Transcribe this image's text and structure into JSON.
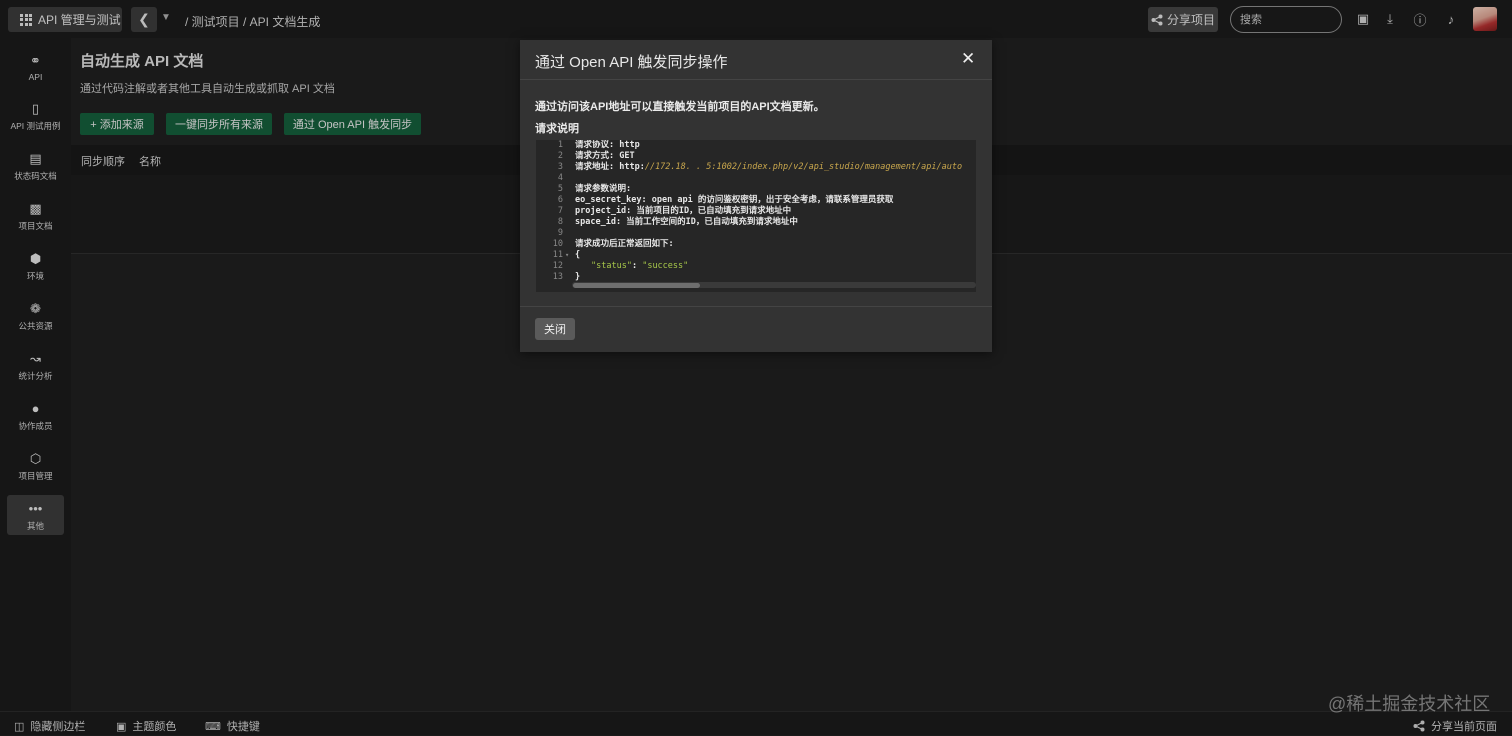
{
  "topbar": {
    "app_label": "API 管理与测试",
    "breadcrumb": "/ 测试项目 / API 文档生成",
    "share_label": "分享项目",
    "search_placeholder": "搜索"
  },
  "sidebar": {
    "items": [
      {
        "label": "API",
        "icon": "link-icon"
      },
      {
        "label": "API 测试用例",
        "icon": "test-case-icon"
      },
      {
        "label": "状态码文档",
        "icon": "status-doc-icon"
      },
      {
        "label": "项目文档",
        "icon": "project-doc-icon"
      },
      {
        "label": "环境",
        "icon": "environment-icon"
      },
      {
        "label": "公共资源",
        "icon": "public-resource-icon"
      },
      {
        "label": "统计分析",
        "icon": "chart-icon"
      },
      {
        "label": "协作成员",
        "icon": "member-icon"
      },
      {
        "label": "项目管理",
        "icon": "settings-icon"
      },
      {
        "label": "其他",
        "icon": "more-icon"
      }
    ]
  },
  "main": {
    "title": "自动生成 API 文档",
    "description": "通过代码注解或者其他工具自动生成或抓取 API 文档",
    "buttons": {
      "add_source": "+ 添加来源",
      "sync_all": "一键同步所有来源",
      "open_api_sync": "通过 Open API 触发同步"
    },
    "columns": [
      "同步顺序",
      "名称"
    ]
  },
  "modal": {
    "title": "通过 Open API 触发同步操作",
    "intro": "通过访问该API地址可以直接触发当前项目的API文档更新。",
    "section_title": "请求说明",
    "code_lines": {
      "l1": "请求协议: http",
      "l2": "请求方式: GET",
      "l3_prefix": "请求地址: http:",
      "l3_url": "//172.18.  .  5:1002/index.php/v2/api_studio/management/api/auto",
      "l5": "请求参数说明:",
      "l6": "eo_secret_key: open api 的访问鉴权密钥，出于安全考虑，请联系管理员获取",
      "l7": "project_id: 当前项目的ID，已自动填充到请求地址中",
      "l8": "space_id: 当前工作空间的ID，已自动填充到请求地址中",
      "l10": "请求成功后正常返回如下:",
      "l11": "{",
      "l12_key": "\"status\"",
      "l12_sep": ": ",
      "l12_val": "\"success\"",
      "l13": "}"
    },
    "line_numbers": [
      "1",
      "2",
      "3",
      "4",
      "5",
      "6",
      "7",
      "8",
      "9",
      "10",
      "11",
      "12",
      "13"
    ],
    "close_label": "关闭"
  },
  "bottombar": {
    "hide_sidebar": "隐藏侧边栏",
    "theme_color": "主题颜色",
    "shortcuts": "快捷键",
    "share_page": "分享当前页面"
  },
  "watermark": "@稀土掘金技术社区"
}
